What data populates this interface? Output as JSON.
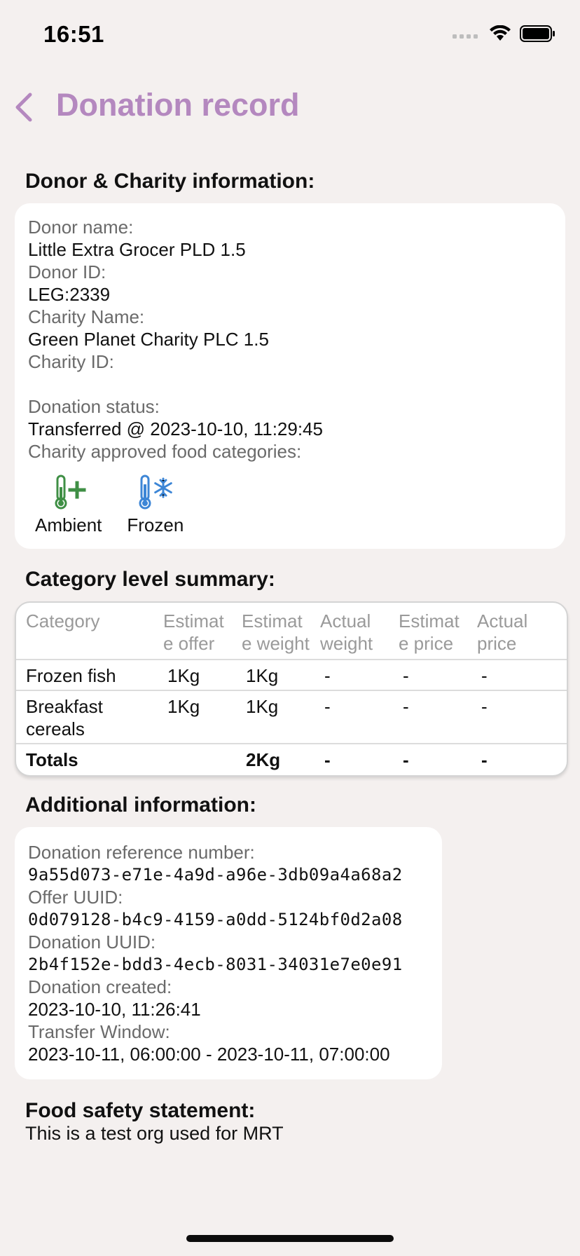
{
  "status_bar": {
    "time": "16:51"
  },
  "header": {
    "title": "Donation record",
    "back_icon": "chevron-left-icon"
  },
  "donor_section": {
    "heading": "Donor & Charity information:",
    "donor_name_label": "Donor name:",
    "donor_name": "Little Extra Grocer PLD 1.5",
    "donor_id_label": "Donor ID:",
    "donor_id": "LEG:2339",
    "charity_name_label": "Charity Name:",
    "charity_name": "Green Planet Charity PLC 1.5",
    "charity_id_label": "Charity ID:",
    "charity_id": "",
    "status_label": "Donation status:",
    "status": "Transferred @ 2023-10-10, 11:29:45",
    "categories_label": "Charity approved food categories:",
    "categories": [
      {
        "label": "Ambient",
        "icon": "thermometer-plus-icon",
        "color": "#3f8f45"
      },
      {
        "label": "Frozen",
        "icon": "thermometer-snowflake-icon",
        "color": "#3d86d6"
      }
    ]
  },
  "summary_section": {
    "heading": "Category level summary:",
    "columns": [
      "Category",
      "Estimate offer",
      "Estimate weight",
      "Actual weight",
      "Estimate price",
      "Actual price"
    ],
    "column_lines": [
      [
        "Category"
      ],
      [
        "Estimat",
        "e offer"
      ],
      [
        "Estimat",
        "e weight"
      ],
      [
        "Actual",
        "weight"
      ],
      [
        "Estimat",
        "e price"
      ],
      [
        "Actual",
        "price"
      ]
    ],
    "rows": [
      [
        "Frozen fish",
        "1Kg",
        "1Kg",
        "-",
        "-",
        "-"
      ],
      [
        "Breakfast cereals",
        "1Kg",
        "1Kg",
        "-",
        "-",
        "-"
      ]
    ],
    "totals": [
      "Totals",
      "",
      "2Kg",
      "-",
      "-",
      "-"
    ]
  },
  "additional_section": {
    "heading": "Additional information:",
    "ref_label": "Donation reference number:",
    "ref": "9a55d073-e71e-4a9d-a96e-3db09a4a68a2",
    "offer_uuid_label": "Offer UUID:",
    "offer_uuid": "0d079128-b4c9-4159-a0dd-5124bf0d2a08",
    "donation_uuid_label": "Donation UUID:",
    "donation_uuid": "2b4f152e-bdd3-4ecb-8031-34031e7e0e91",
    "created_label": "Donation created:",
    "created": "2023-10-10, 11:26:41",
    "window_label": "Transfer Window:",
    "window": "2023-10-11, 06:00:00 - 2023-10-11, 07:00:00"
  },
  "food_safety": {
    "heading": "Food safety statement:",
    "text": "This is a test org used for MRT"
  },
  "colors": {
    "background": "#f4f0ef",
    "title_accent": "#b488bf",
    "ambient_green": "#3f8f45",
    "frozen_blue": "#3d86d6"
  }
}
